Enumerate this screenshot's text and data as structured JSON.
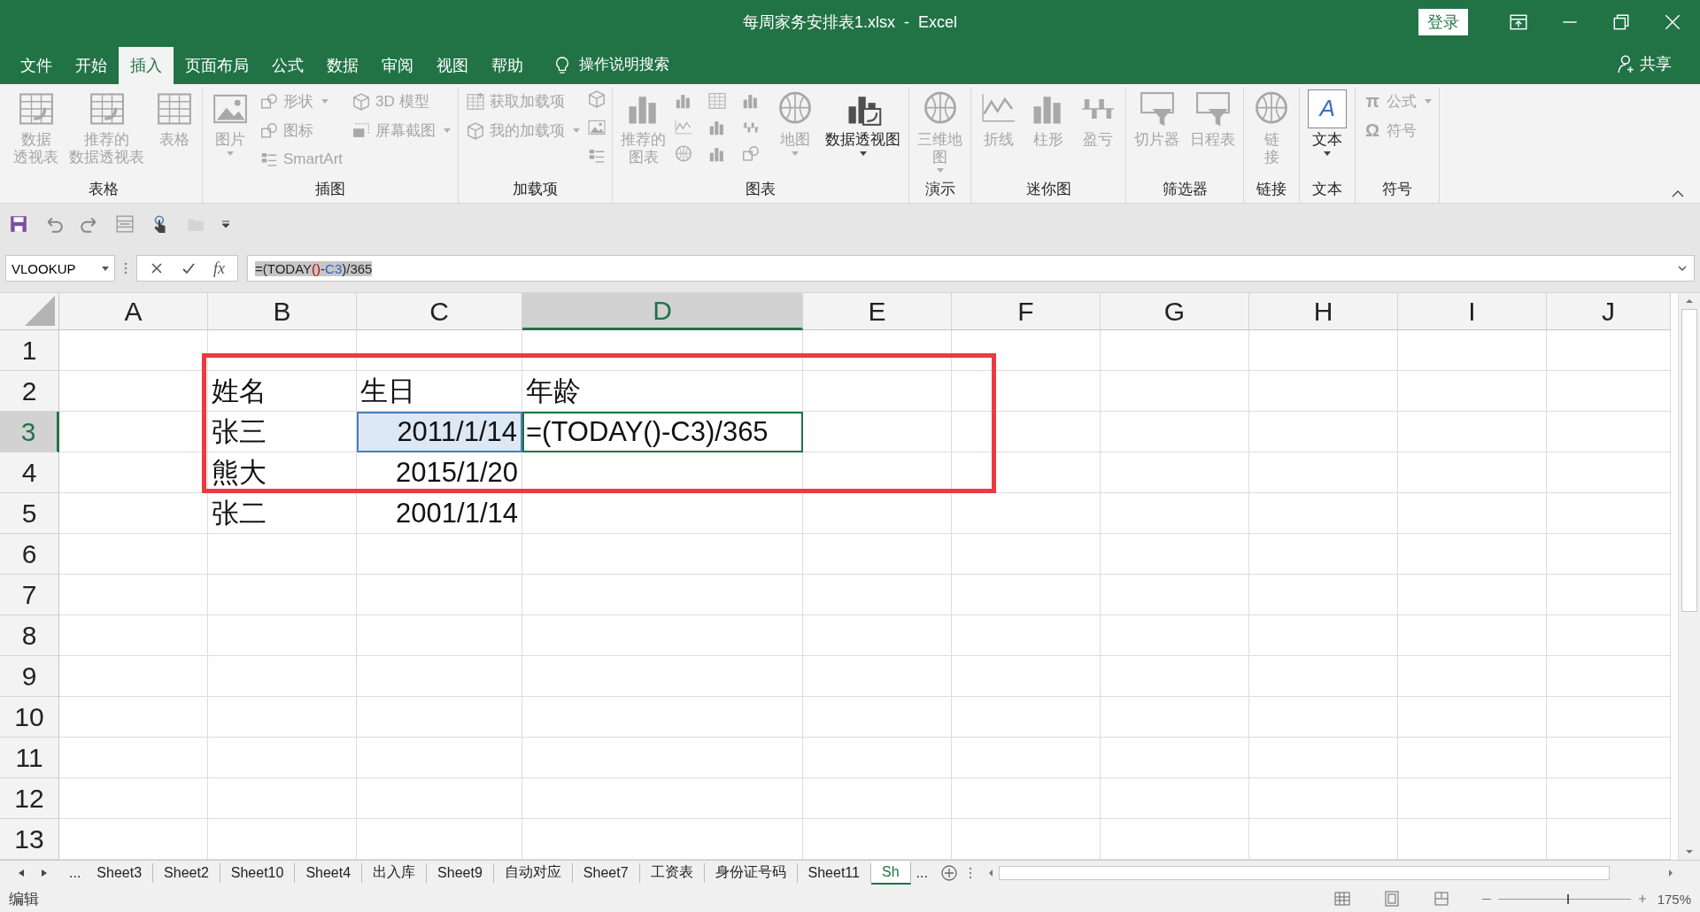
{
  "window": {
    "title": "每周家务安排表1.xlsx  -  Excel",
    "sign_in": "登录"
  },
  "tabs": [
    {
      "label": "文件",
      "selected": false
    },
    {
      "label": "开始",
      "selected": false
    },
    {
      "label": "插入",
      "selected": true
    },
    {
      "label": "页面布局",
      "selected": false
    },
    {
      "label": "公式",
      "selected": false
    },
    {
      "label": "数据",
      "selected": false
    },
    {
      "label": "审阅",
      "selected": false
    },
    {
      "label": "视图",
      "selected": false
    },
    {
      "label": "帮助",
      "selected": false
    }
  ],
  "tell_me": "操作说明搜索",
  "share": "共享",
  "ribbon": {
    "groups": [
      {
        "label": "表格",
        "columns": [
          [
            {
              "kind": "large",
              "lines": [
                "数据",
                "透视表"
              ],
              "disabled": true,
              "dropdown": false
            }
          ],
          [
            {
              "kind": "large",
              "lines": [
                "推荐的",
                "数据透视表"
              ],
              "disabled": true,
              "dropdown": false
            }
          ],
          [
            {
              "kind": "large",
              "lines": [
                "表格"
              ],
              "disabled": true,
              "dropdown": false
            }
          ]
        ]
      },
      {
        "label": "插图",
        "columns": [
          [
            {
              "kind": "large",
              "lines": [
                "图片"
              ],
              "disabled": true,
              "dropdown": true
            }
          ],
          [
            {
              "kind": "small",
              "label": "形状",
              "disabled": true,
              "dropdown": true
            },
            {
              "kind": "small",
              "label": "图标",
              "disabled": true,
              "dropdown": false
            },
            {
              "kind": "small",
              "label": "SmartArt",
              "disabled": true,
              "dropdown": false
            }
          ],
          [
            {
              "kind": "small",
              "label": "3D 模型",
              "disabled": true,
              "dropdown": false
            },
            {
              "kind": "small",
              "label": "屏幕截图",
              "disabled": true,
              "dropdown": true
            }
          ]
        ]
      },
      {
        "label": "加载项",
        "columns": [
          [
            {
              "kind": "small",
              "label": "获取加载项",
              "disabled": true,
              "dropdown": false
            },
            {
              "kind": "small",
              "label": "我的加载项",
              "disabled": true,
              "dropdown": true
            }
          ],
          [
            {
              "kind": "icon-stack"
            }
          ]
        ]
      },
      {
        "label": "图表",
        "columns": [
          [
            {
              "kind": "large",
              "lines": [
                "推荐的",
                "图表"
              ],
              "disabled": true,
              "dropdown": false
            }
          ],
          [
            {
              "kind": "icon-grid"
            }
          ],
          [
            {
              "kind": "large",
              "lines": [
                "地图"
              ],
              "disabled": true,
              "dropdown": true
            }
          ],
          [
            {
              "kind": "large",
              "lines": [
                "数据透视图"
              ],
              "disabled": false,
              "dropdown": true
            }
          ]
        ]
      },
      {
        "label": "演示",
        "columns": [
          [
            {
              "kind": "large",
              "lines": [
                "三维地",
                "图"
              ],
              "disabled": true,
              "dropdown": true
            }
          ]
        ]
      },
      {
        "label": "迷你图",
        "columns": [
          [
            {
              "kind": "large",
              "lines": [
                "折线"
              ],
              "disabled": true,
              "dropdown": false
            }
          ],
          [
            {
              "kind": "large",
              "lines": [
                "柱形"
              ],
              "disabled": true,
              "dropdown": false
            }
          ],
          [
            {
              "kind": "large",
              "lines": [
                "盈亏"
              ],
              "disabled": true,
              "dropdown": false
            }
          ]
        ]
      },
      {
        "label": "筛选器",
        "columns": [
          [
            {
              "kind": "large",
              "lines": [
                "切片器"
              ],
              "disabled": true,
              "dropdown": false
            }
          ],
          [
            {
              "kind": "large",
              "lines": [
                "日程表"
              ],
              "disabled": true,
              "dropdown": false
            }
          ]
        ]
      },
      {
        "label": "链接",
        "columns": [
          [
            {
              "kind": "large",
              "lines": [
                "链",
                "接"
              ],
              "disabled": true,
              "dropdown": false
            }
          ]
        ]
      },
      {
        "label": "文本",
        "columns": [
          [
            {
              "kind": "large",
              "lines": [
                "文本"
              ],
              "disabled": false,
              "dropdown": true,
              "glyph": "A"
            }
          ]
        ]
      },
      {
        "label": "符号",
        "columns": [
          [
            {
              "kind": "small",
              "label": "公式",
              "disabled": true,
              "dropdown": true,
              "glyph": "π"
            },
            {
              "kind": "small",
              "label": "符号",
              "disabled": true,
              "dropdown": false,
              "glyph": "Ω"
            }
          ]
        ]
      }
    ]
  },
  "formula_bar": {
    "name_box": "VLOOKUP",
    "function_button": "fx",
    "formula": {
      "selected": true,
      "segments": [
        {
          "text": "=(TODAY",
          "color": "#262626"
        },
        {
          "text": "()",
          "color": "#c00000"
        },
        {
          "text": "-",
          "color": "#262626"
        },
        {
          "text": "C3",
          "color": "#2f5cd0"
        },
        {
          "text": ")/365",
          "color": "#262626"
        }
      ]
    }
  },
  "sheet": {
    "columns": [
      {
        "label": "A",
        "selected": false
      },
      {
        "label": "B",
        "selected": false
      },
      {
        "label": "C",
        "selected": false
      },
      {
        "label": "D",
        "selected": true
      },
      {
        "label": "E",
        "selected": false
      },
      {
        "label": "F",
        "selected": false
      },
      {
        "label": "G",
        "selected": false
      },
      {
        "label": "H",
        "selected": false
      },
      {
        "label": "I",
        "selected": false
      },
      {
        "label": "J",
        "selected": false
      }
    ],
    "rows": [
      {
        "label": "1",
        "selected": false,
        "cells": []
      },
      {
        "label": "2",
        "selected": false,
        "cells": [
          {
            "text": "",
            "kind": "text",
            "selected": false,
            "editing": false
          },
          {
            "text": "姓名",
            "kind": "text",
            "selected": false,
            "editing": false
          },
          {
            "text": "生日",
            "kind": "text",
            "selected": false,
            "editing": false
          },
          {
            "text": "年龄",
            "kind": "text",
            "selected": false,
            "editing": false
          }
        ]
      },
      {
        "label": "3",
        "selected": true,
        "cells": [
          {
            "text": "",
            "kind": "text",
            "selected": false,
            "editing": false
          },
          {
            "text": "张三",
            "kind": "text",
            "selected": false,
            "editing": false
          },
          {
            "text": "2011/1/14",
            "kind": "number",
            "selected": true,
            "editing": false
          },
          {
            "text": "=(TODAY()-C3)/365",
            "kind": "text",
            "selected": false,
            "editing": true
          }
        ]
      },
      {
        "label": "4",
        "selected": false,
        "cells": [
          {
            "text": "",
            "kind": "text",
            "selected": false,
            "editing": false
          },
          {
            "text": "熊大",
            "kind": "text",
            "selected": false,
            "editing": false
          },
          {
            "text": "2015/1/20",
            "kind": "number",
            "selected": false,
            "editing": false
          }
        ]
      },
      {
        "label": "5",
        "selected": false,
        "cells": [
          {
            "text": "",
            "kind": "text",
            "selected": false,
            "editing": false
          },
          {
            "text": "张二",
            "kind": "text",
            "selected": false,
            "editing": false
          },
          {
            "text": "2001/1/14",
            "kind": "number",
            "selected": false,
            "editing": false
          }
        ]
      },
      {
        "label": "6",
        "selected": false,
        "cells": []
      },
      {
        "label": "7",
        "selected": false,
        "cells": []
      },
      {
        "label": "8",
        "selected": false,
        "cells": []
      },
      {
        "label": "9",
        "selected": false,
        "cells": []
      },
      {
        "label": "10",
        "selected": false,
        "cells": []
      },
      {
        "label": "11",
        "selected": false,
        "cells": []
      },
      {
        "label": "12",
        "selected": false,
        "cells": []
      },
      {
        "label": "13",
        "selected": false,
        "cells": []
      }
    ]
  },
  "sheet_tabs": {
    "overflow_left": "...",
    "tabs": [
      {
        "label": "Sheet3",
        "selected": false
      },
      {
        "label": "Sheet2",
        "selected": false
      },
      {
        "label": "Sheet10",
        "selected": false
      },
      {
        "label": "Sheet4",
        "selected": false
      },
      {
        "label": "出入库",
        "selected": false
      },
      {
        "label": "Sheet9",
        "selected": false
      },
      {
        "label": "自动对应",
        "selected": false
      },
      {
        "label": "Sheet7",
        "selected": false
      },
      {
        "label": "工资表",
        "selected": false
      },
      {
        "label": "身份证号码",
        "selected": false
      },
      {
        "label": "Sheet11",
        "selected": false
      },
      {
        "label": "Sh",
        "selected": true
      }
    ],
    "overflow_right": "..."
  },
  "status_bar": {
    "mode": "编辑",
    "zoom_slider": {
      "level": 0.52
    },
    "zoom": "175%"
  }
}
